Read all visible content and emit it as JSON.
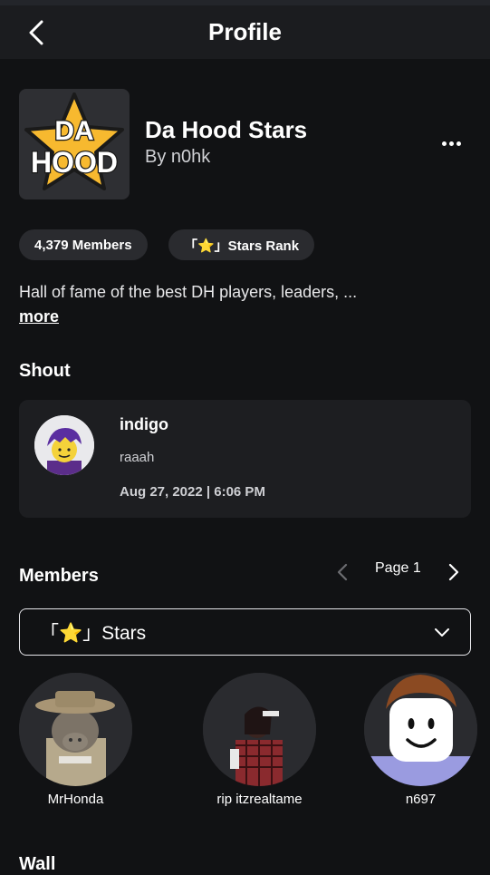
{
  "nav": {
    "title": "Profile"
  },
  "group": {
    "logo_text_top": "DA",
    "logo_text_bottom": "HOOD",
    "name": "Da Hood Stars",
    "owner": "By n0hk",
    "members_pill": "4,379 Members",
    "rank_pill": "「⭐」Stars Rank",
    "description": "Hall of fame of the best DH players, leaders, ...",
    "more_label": "more"
  },
  "shout": {
    "section_title": "Shout",
    "user": "indigo",
    "message": "raaah",
    "date": "Aug 27, 2022 | 6:06 PM"
  },
  "members": {
    "section_title": "Members",
    "page_label": "Page 1",
    "role_selected": "「⭐」Stars",
    "list": [
      {
        "name": "MrHonda"
      },
      {
        "name": "rip itzrealtame"
      },
      {
        "name": "n697"
      }
    ]
  },
  "wall": {
    "section_title": "Wall"
  },
  "colors": {
    "background": "#111214",
    "card": "#1d1e21",
    "logo_yellow": "#f7b92f"
  }
}
